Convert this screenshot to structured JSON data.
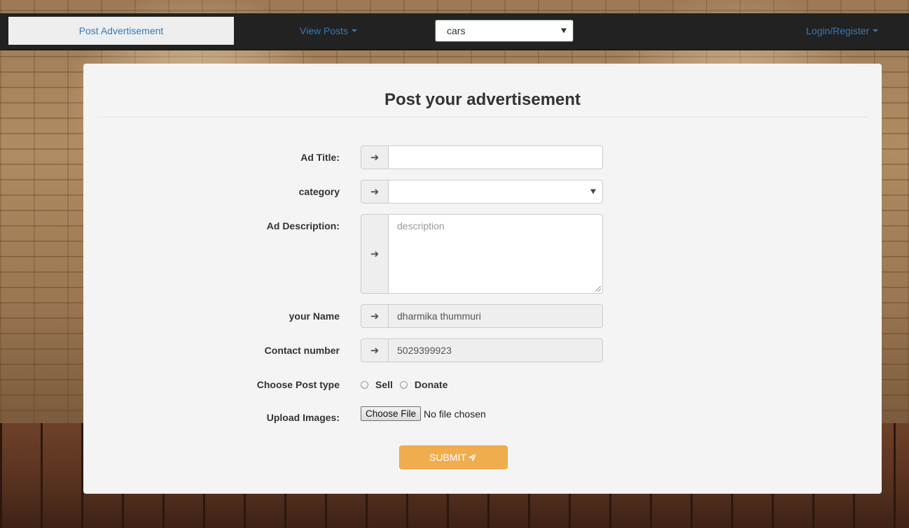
{
  "nav": {
    "post_ad": "Post Advertisement",
    "view_posts": "View Posts",
    "category_select_value": "cars",
    "login_register": "Login/Register"
  },
  "form": {
    "title": "Post your advertisement",
    "ad_title_label": "Ad Title:",
    "ad_title_value": "",
    "category_label": "category",
    "category_value": "",
    "description_label": "Ad Description:",
    "description_placeholder": "description",
    "name_label": "your Name",
    "name_value": "dharmika thummuri",
    "contact_label": "Contact number",
    "contact_value": "5029399923",
    "post_type_label": "Choose Post type",
    "post_type_options": [
      "Sell",
      "Donate"
    ],
    "upload_label": "Upload Images:",
    "choose_file_label": "Choose File",
    "no_file_text": "No file chosen",
    "submit_label": "SUBMIT"
  },
  "icons": {
    "addon_icon": "arrow-right-icon",
    "submit_icon": "send-icon"
  },
  "colors": {
    "link": "#337ab7",
    "navbar_bg": "#222222",
    "submit_bg": "#f0ad4e",
    "panel_bg": "#f4f4f4"
  }
}
